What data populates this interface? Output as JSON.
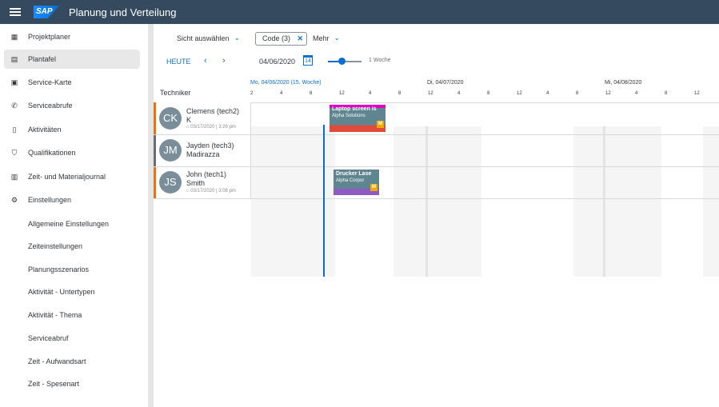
{
  "shell": {
    "logo": "SAP",
    "title": "Planung und Verteilung"
  },
  "sidebar": {
    "items": [
      {
        "label": "Projektplaner",
        "icon": "project-planner-icon"
      },
      {
        "label": "Plantafel",
        "icon": "planning-board-icon",
        "selected": true
      },
      {
        "label": "Service-Karte",
        "icon": "map-icon"
      },
      {
        "label": "Serviceabrufe",
        "icon": "phone-icon"
      },
      {
        "label": "Aktivitäten",
        "icon": "activity-clipboard-icon"
      },
      {
        "label": "Qualifikationen",
        "icon": "badge-icon"
      },
      {
        "label": "Zeit- und Materialjournal",
        "icon": "journal-icon"
      },
      {
        "label": "Einstellungen",
        "icon": "gear-icon"
      }
    ],
    "subitems": [
      "Allgemeine Einstellungen",
      "Zeiteinstellungen",
      "Planungsszenarios",
      "Aktivität - Untertypen",
      "Aktivität - Thema",
      "Serviceabruf",
      "Zeit - Aufwandsart",
      "Zeit - Spesenart"
    ]
  },
  "toolbar": {
    "view_select": "Sicht auswählen",
    "code_chip": "Code (3)",
    "more": "Mehr",
    "today": "HEUTE",
    "date": "04/06/2020",
    "calendar_day": "14",
    "zoom_label": "1 Woche",
    "zoom_level": 0.4
  },
  "board": {
    "technician_header": "Techniker",
    "days": [
      {
        "label": "Mo, 04/06/2020 (15. Woche)",
        "current": true
      },
      {
        "label": "Di, 04/07/2020"
      },
      {
        "label": "Mi, 04/08/2020"
      }
    ],
    "ticks": [
      "2",
      "4",
      "8",
      "12",
      "4",
      "8",
      "12",
      "4",
      "8",
      "12",
      "4",
      "8",
      "12",
      "4",
      "8",
      "12"
    ],
    "technicians": [
      {
        "initials": "CK",
        "name": "Clemens (tech2)",
        "last": "K",
        "updated": "03/17/2020 | 3:26 pm",
        "marker": "#e9730c"
      },
      {
        "initials": "JM",
        "name": "Jayden (tech3)",
        "last": "Madirazza",
        "updated": "",
        "marker": "#6a6d70"
      },
      {
        "initials": "JS",
        "name": "John (tech1)",
        "last": "Smith",
        "updated": "03/17/2020 | 3:08 pm",
        "marker": "#e9730c"
      }
    ],
    "appointments": [
      {
        "title": "Laptop screen is",
        "customer": "Alpha Solutions",
        "badge": "M",
        "top_color": "#e000c8",
        "body_color": "#5f8591",
        "bottom_color": "#e04a3a"
      },
      {
        "title": "Drucker Lase",
        "customer": "Alpha Corpor",
        "badge": "M",
        "top_color": "#5f8591",
        "body_color": "#5f8591",
        "bottom_color": "#8e5bc4"
      }
    ]
  }
}
